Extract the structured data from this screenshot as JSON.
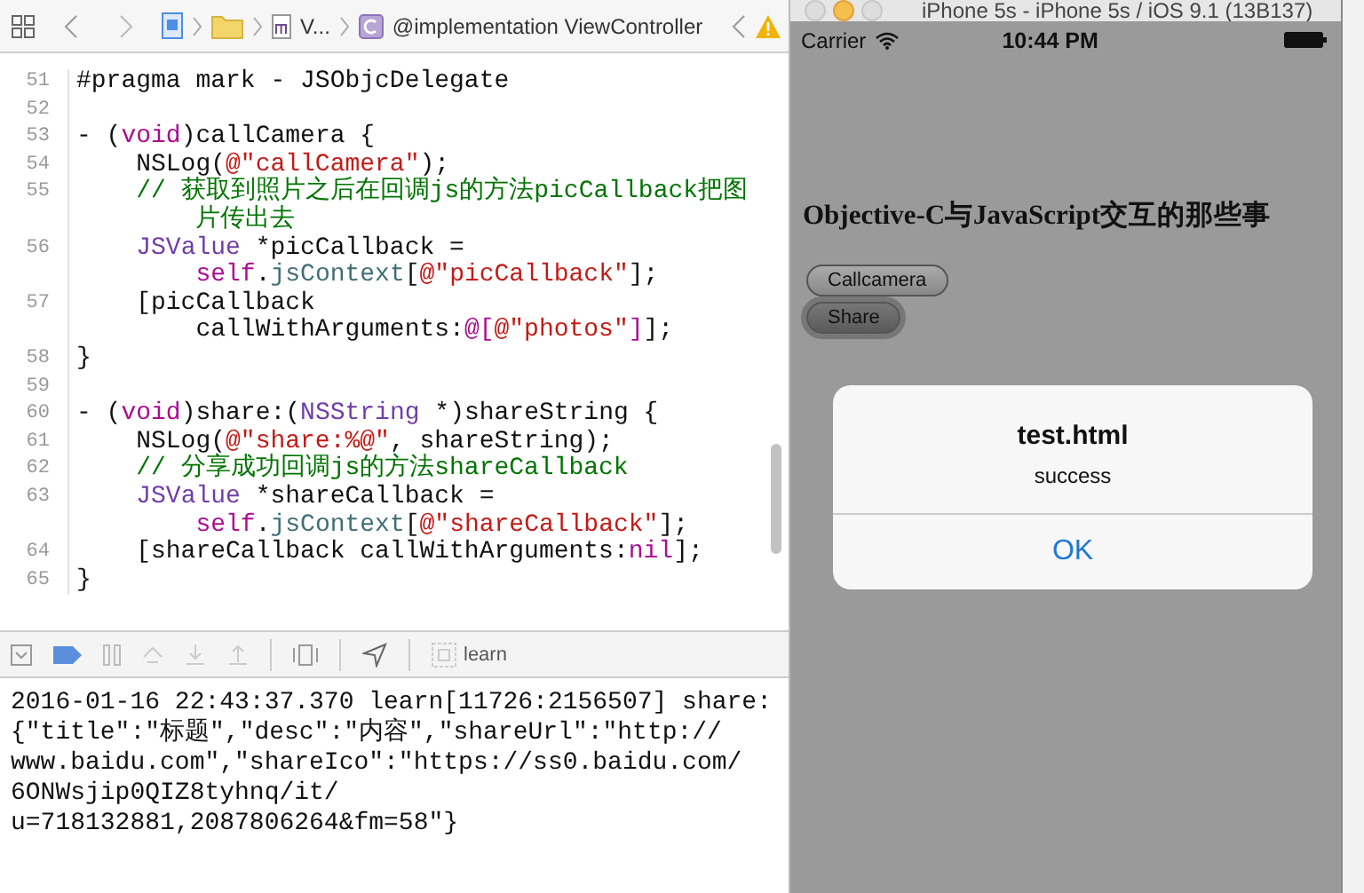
{
  "editor": {
    "breadcrumb": {
      "file": "V...",
      "symbol": "@implementation ViewController"
    },
    "lines": [
      {
        "number": "51",
        "rows": [
          [
            {
              "text": "#pragma mark - JSObjcDelegate",
              "kind": "plain"
            }
          ]
        ]
      },
      {
        "number": "52"
      },
      {
        "number": "53",
        "rows": [
          [
            {
              "text": "- (",
              "kind": "plain"
            },
            {
              "text": "void",
              "kind": "keyword"
            },
            {
              "text": ")callCamera {",
              "kind": "plain"
            }
          ]
        ]
      },
      {
        "number": "54",
        "rows": [
          [
            {
              "text": "    NSLog(",
              "kind": "plain"
            },
            {
              "text": "@\"callCamera\"",
              "kind": "string"
            },
            {
              "text": ");",
              "kind": "plain"
            }
          ]
        ]
      },
      {
        "number": "55",
        "rows": [
          [
            {
              "text": "    // 获取到照片之后在回调js的方法picCallback把图",
              "kind": "comment"
            }
          ],
          [
            {
              "text": "        片传出去",
              "kind": "comment"
            }
          ]
        ]
      },
      {
        "number": "56",
        "rows": [
          [
            {
              "text": "    ",
              "kind": "plain"
            },
            {
              "text": "JSValue",
              "kind": "type"
            },
            {
              "text": " *picCallback =",
              "kind": "plain"
            }
          ],
          [
            {
              "text": "        ",
              "kind": "plain"
            },
            {
              "text": "self",
              "kind": "keyword"
            },
            {
              "text": ".",
              "kind": "plain"
            },
            {
              "text": "jsContext",
              "kind": "member"
            },
            {
              "text": "[",
              "kind": "plain"
            },
            {
              "text": "@\"picCallback\"",
              "kind": "string"
            },
            {
              "text": "];",
              "kind": "plain"
            }
          ]
        ]
      },
      {
        "number": "57",
        "rows": [
          [
            {
              "text": "    [picCallback",
              "kind": "plain"
            }
          ],
          [
            {
              "text": "        callWithArguments:",
              "kind": "plain"
            },
            {
              "text": "@[",
              "kind": "keyword"
            },
            {
              "text": "@\"photos\"",
              "kind": "string"
            },
            {
              "text": "]",
              "kind": "keyword"
            },
            {
              "text": "];",
              "kind": "plain"
            }
          ]
        ]
      },
      {
        "number": "58",
        "rows": [
          [
            {
              "text": "}",
              "kind": "plain"
            }
          ]
        ]
      },
      {
        "number": "59"
      },
      {
        "number": "60",
        "rows": [
          [
            {
              "text": "- (",
              "kind": "plain"
            },
            {
              "text": "void",
              "kind": "keyword"
            },
            {
              "text": ")share:(",
              "kind": "plain"
            },
            {
              "text": "NSString",
              "kind": "type"
            },
            {
              "text": " *)shareString {",
              "kind": "plain"
            }
          ]
        ]
      },
      {
        "number": "61",
        "rows": [
          [
            {
              "text": "    NSLog(",
              "kind": "plain"
            },
            {
              "text": "@\"share:%@\"",
              "kind": "string"
            },
            {
              "text": ", shareString);",
              "kind": "plain"
            }
          ]
        ]
      },
      {
        "number": "62",
        "rows": [
          [
            {
              "text": "    // 分享成功回调js的方法shareCallback",
              "kind": "comment"
            }
          ]
        ]
      },
      {
        "number": "63",
        "rows": [
          [
            {
              "text": "    ",
              "kind": "plain"
            },
            {
              "text": "JSValue",
              "kind": "type"
            },
            {
              "text": " *shareCallback =",
              "kind": "plain"
            }
          ],
          [
            {
              "text": "        ",
              "kind": "plain"
            },
            {
              "text": "self",
              "kind": "keyword"
            },
            {
              "text": ".",
              "kind": "plain"
            },
            {
              "text": "jsContext",
              "kind": "member"
            },
            {
              "text": "[",
              "kind": "plain"
            },
            {
              "text": "@\"shareCallback\"",
              "kind": "string"
            },
            {
              "text": "];",
              "kind": "plain"
            }
          ]
        ]
      },
      {
        "number": "64",
        "rows": [
          [
            {
              "text": "    [shareCallback callWithArguments:",
              "kind": "plain"
            },
            {
              "text": "nil",
              "kind": "keyword"
            },
            {
              "text": "];",
              "kind": "plain"
            }
          ]
        ]
      },
      {
        "number": "65",
        "rows": [
          [
            {
              "text": "}",
              "kind": "plain"
            }
          ]
        ]
      }
    ]
  },
  "debug_bar": {
    "target": "learn"
  },
  "console": {
    "lines": [
      "2016-01-16 22:43:37.370 learn[11726:2156507] share:",
      "{\"title\":\"标题\",\"desc\":\"内容\",\"shareUrl\":\"http://",
      "www.baidu.com\",\"shareIco\":\"https://ss0.baidu.com/",
      "6ONWsjip0QIZ8tyhnq/it/",
      "u=718132881,2087806264&fm=58\"}"
    ]
  },
  "simulator": {
    "title": "iPhone 5s - iPhone 5s / iOS 9.1 (13B137)",
    "status_bar": {
      "carrier": "Carrier",
      "time": "10:44 PM"
    },
    "heading": "Objective-C与JavaScript交互的那些事",
    "buttons": [
      {
        "label": "Callcamera",
        "pressed": false
      },
      {
        "label": "Share",
        "pressed": true
      }
    ],
    "alert": {
      "title": "test.html",
      "message": "success",
      "action": "OK"
    }
  }
}
